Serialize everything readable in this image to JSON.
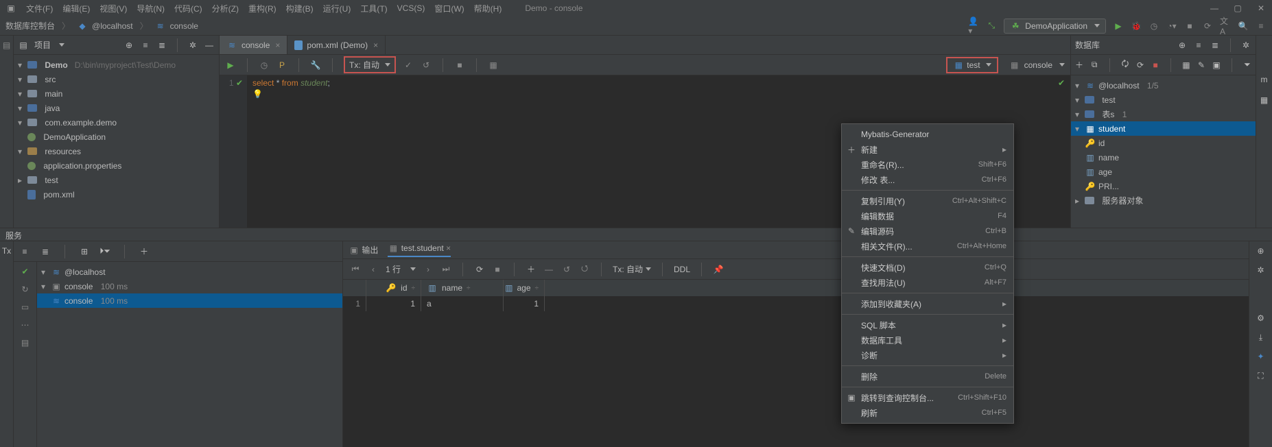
{
  "menu": [
    "文件(F)",
    "编辑(E)",
    "视图(V)",
    "导航(N)",
    "代码(C)",
    "分析(Z)",
    "重构(R)",
    "构建(B)",
    "运行(U)",
    "工具(T)",
    "VCS(S)",
    "窗口(W)",
    "帮助(H)"
  ],
  "window_title": "Demo - console",
  "breadcrumb": {
    "a": "数据库控制台",
    "b": "@localhost",
    "c": "console"
  },
  "run_config": "DemoApplication",
  "project": {
    "label": "项目",
    "root": "Demo",
    "root_path": "D:\\bin\\myproject\\Test\\Demo",
    "n_src": "src",
    "n_main": "main",
    "n_java": "java",
    "n_pkg": "com.example.demo",
    "n_app": "DemoApplication",
    "n_res": "resources",
    "n_prop": "application.properties",
    "n_test": "test",
    "n_pom": "pom.xml"
  },
  "editor": {
    "tabs": [
      {
        "label": "console"
      },
      {
        "label": "pom.xml (Demo)"
      }
    ],
    "tx": "Tx: 自动",
    "schema": "test",
    "console": "console",
    "line": "1",
    "sql": {
      "kw1": "select",
      "star": "*",
      "kw2": "from",
      "tbl": "student",
      "semi": ";"
    }
  },
  "db": {
    "title": "数据库",
    "host": "@localhost",
    "host_badge": "1/5",
    "schema": "test",
    "tables_label": "表s",
    "tables_count": "1",
    "table": "student",
    "cols": {
      "id": "id",
      "name": "name",
      "age": "age",
      "pri": "PRI..."
    },
    "srv": "服务器对象"
  },
  "services": {
    "title": "服务",
    "tx_label": "Tx",
    "host": "@localhost",
    "c1": "console",
    "c1_time": "100 ms",
    "c2": "console",
    "c2_time": "100 ms"
  },
  "results": {
    "tab_out": "输出",
    "tab_grid": "test.student",
    "rows_label": "1 行",
    "tx": "Tx: 自动",
    "ddl": "DDL",
    "headers": {
      "id": "id",
      "name": "name",
      "age": "age"
    },
    "row": {
      "n": "1",
      "id": "1",
      "name": "a",
      "age": "1"
    }
  },
  "ctx": {
    "gen": "Mybatis-Generator",
    "new": "新建",
    "rename": "重命名(R)...",
    "rename_sc": "Shift+F6",
    "modify": "修改 表...",
    "modify_sc": "Ctrl+F6",
    "copyref": "复制引用(Y)",
    "copyref_sc": "Ctrl+Alt+Shift+C",
    "editdata": "编辑数据",
    "editdata_sc": "F4",
    "editsrc": "编辑源码",
    "editsrc_sc": "Ctrl+B",
    "related": "相关文件(R)...",
    "related_sc": "Ctrl+Alt+Home",
    "quickdoc": "快速文档(D)",
    "quickdoc_sc": "Ctrl+Q",
    "findusage": "查找用法(U)",
    "findusage_sc": "Alt+F7",
    "fav": "添加到收藏夹(A)",
    "sql": "SQL 脚本",
    "dbtools": "数据库工具",
    "diag": "诊断",
    "delete": "删除",
    "delete_sc": "Delete",
    "jump": "跳转到查询控制台...",
    "jump_sc": "Ctrl+Shift+F10",
    "refresh": "刷新",
    "refresh_sc": "Ctrl+F5"
  }
}
